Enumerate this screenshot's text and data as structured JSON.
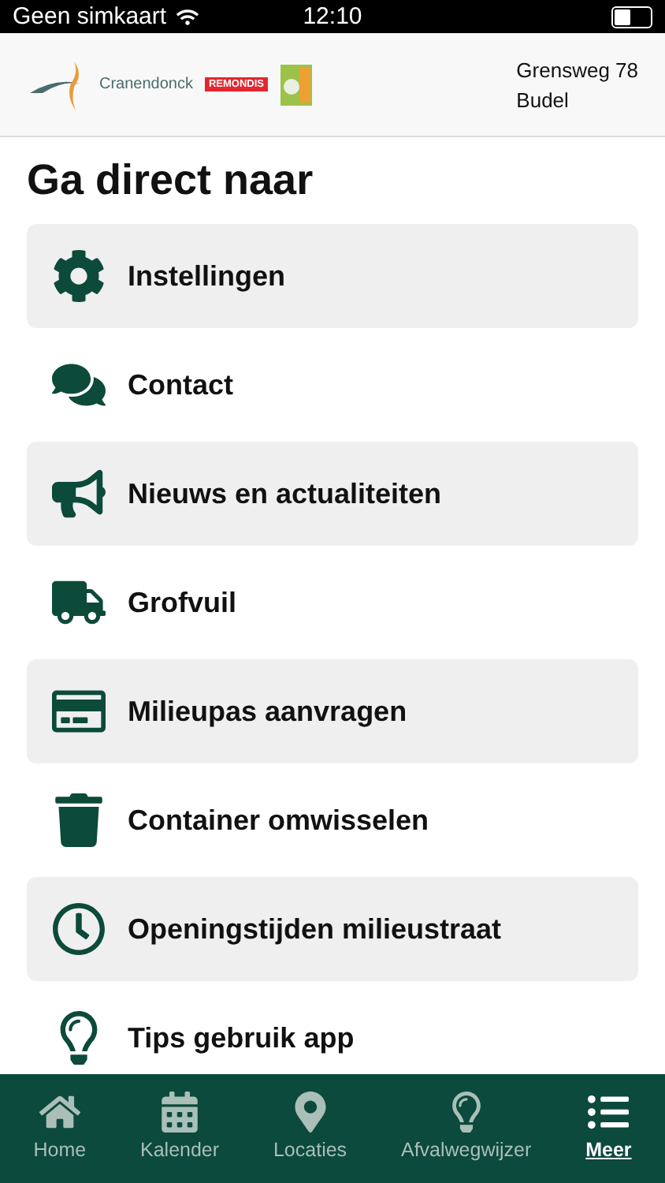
{
  "status_bar": {
    "carrier": "Geen simkaart",
    "time": "12:10"
  },
  "header": {
    "logo_name": "Cranendonck",
    "partner_logo": "REMONDIS",
    "address_line_1": "Grensweg 78",
    "address_line_2": "Budel"
  },
  "title": "Ga direct naar",
  "items": [
    {
      "kind": "settings",
      "label": "Instellingen"
    },
    {
      "kind": "contact",
      "label": "Contact"
    },
    {
      "kind": "news",
      "label": "Nieuws en actualiteiten"
    },
    {
      "kind": "truck",
      "label": "Grofvuil"
    },
    {
      "kind": "card",
      "label": "Milieupas aanvragen"
    },
    {
      "kind": "bin",
      "label": "Container omwisselen"
    },
    {
      "kind": "clock",
      "label": "Openingstijden milieustraat"
    },
    {
      "kind": "tips",
      "label": "Tips gebruik app"
    }
  ],
  "tab_bar": [
    {
      "kind": "home",
      "label": "Home",
      "selected": false
    },
    {
      "kind": "calendar",
      "label": "Kalender",
      "selected": false
    },
    {
      "kind": "location",
      "label": "Locaties",
      "selected": false
    },
    {
      "kind": "tips",
      "label": "Afvalwegwijzer",
      "selected": false
    },
    {
      "kind": "more",
      "label": "Meer",
      "selected": true
    }
  ]
}
